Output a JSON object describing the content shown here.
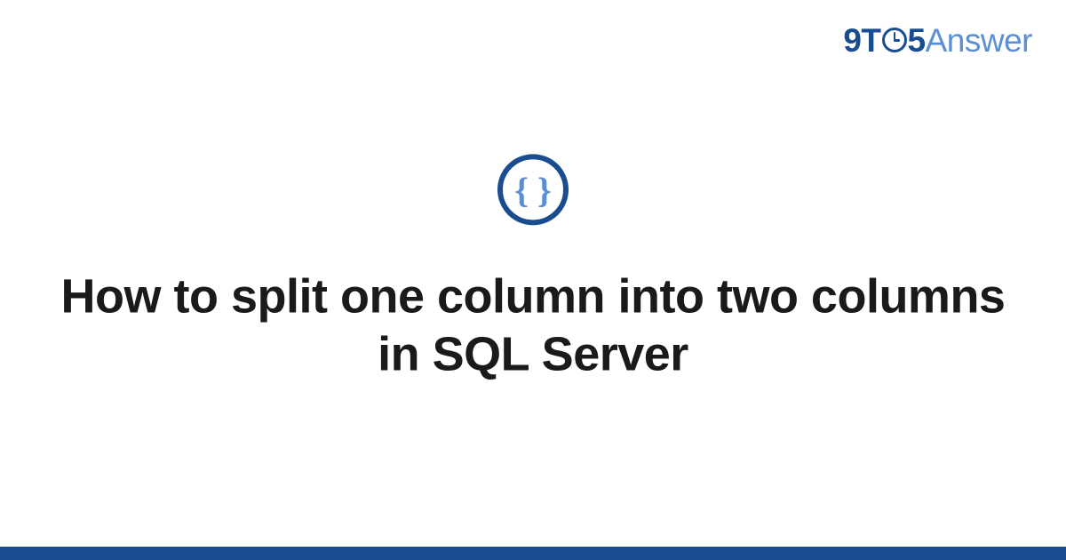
{
  "logo": {
    "nine_t": "9T",
    "five": "5",
    "answer": "Answer"
  },
  "icon": {
    "braces": "{ }"
  },
  "title": "How to split one column into two columns in SQL Server",
  "colors": {
    "primary": "#1a4d8f",
    "accent": "#5a8fd4",
    "text": "#1a1a1a"
  }
}
